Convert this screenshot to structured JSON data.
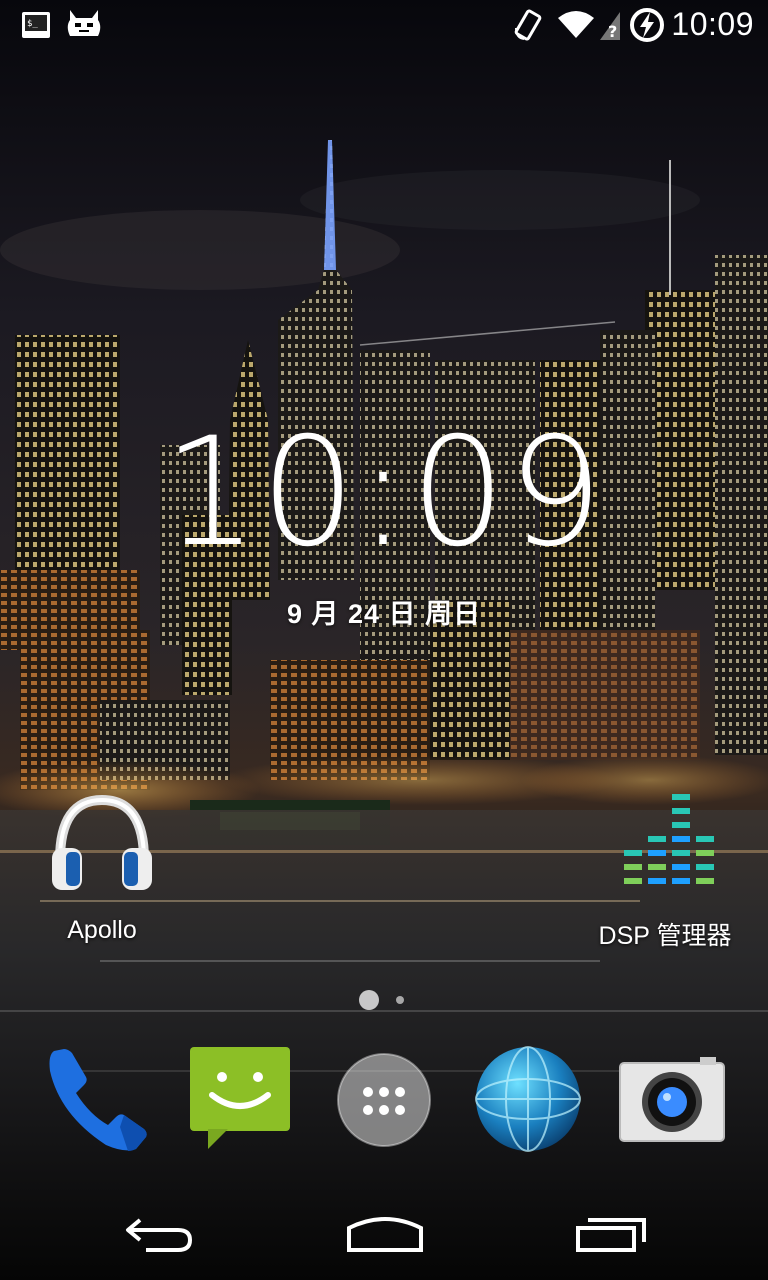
{
  "status_bar": {
    "time": "10:09",
    "left_icons": [
      "terminal-icon",
      "cyanogenmod-icon"
    ],
    "right_icons": [
      "screen-rotation-icon",
      "wifi-icon",
      "battery-charging-icon"
    ]
  },
  "clock_widget": {
    "time": "10:09",
    "date": "9 月 24 日 周日"
  },
  "home_apps": [
    {
      "label": "Apollo",
      "icon": "headphones-icon"
    },
    {
      "label": "DSP 管理器",
      "icon": "equalizer-icon"
    }
  ],
  "page_indicator": {
    "pages": 2,
    "current": 1
  },
  "dock": [
    {
      "icon": "phone-icon"
    },
    {
      "icon": "messaging-icon"
    },
    {
      "icon": "app-drawer-icon"
    },
    {
      "icon": "browser-globe-icon"
    },
    {
      "icon": "camera-icon"
    }
  ],
  "nav_bar": [
    "back-button",
    "home-button",
    "recents-button"
  ],
  "colors": {
    "phone_blue": "#1e6fe0",
    "messaging_green": "#8cbf26",
    "equalizer_blue": "#1ea0ff",
    "equalizer_teal": "#29c7b5",
    "equalizer_green": "#7fcf5a"
  }
}
